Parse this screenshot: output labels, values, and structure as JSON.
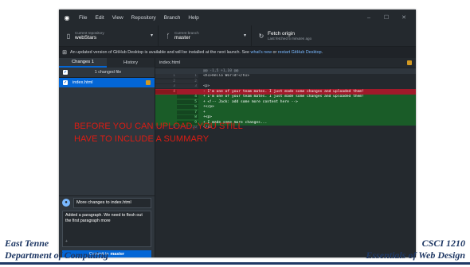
{
  "window": {
    "menus": [
      "File",
      "Edit",
      "View",
      "Repository",
      "Branch",
      "Help"
    ],
    "controls": [
      "–",
      "☐",
      "✕"
    ]
  },
  "toolbar": {
    "repository": {
      "caption": "Current repository",
      "value": "webStars",
      "icon": "repo-icon"
    },
    "branch": {
      "caption": "Current branch",
      "value": "master",
      "icon": "branch-icon"
    },
    "fetch": {
      "title": "Fetch origin",
      "subtitle": "Last fetched 5 minutes ago",
      "icon": "sync-icon"
    }
  },
  "banner": {
    "text": "An updated version of GitHub Desktop is available and will be installed at the next launch. See",
    "link1": "what's new",
    "middle": "or",
    "link2": "restart GitHub Desktop",
    "end": "."
  },
  "sidebar": {
    "tabs": [
      {
        "label": "Changes",
        "badge": "1",
        "active": true
      },
      {
        "label": "History",
        "active": false
      }
    ],
    "changed_header": "1 changed file",
    "files": [
      {
        "name": "index.html",
        "status": "modified"
      }
    ]
  },
  "commit": {
    "summary": "More changes to index.html",
    "description": "Added a paragraph. We need to flesh out the first paragraph more",
    "coauthor_glyph": "+",
    "button_prefix": "Commit to",
    "button_branch": "master"
  },
  "diff": {
    "file": "index.html",
    "lines": [
      {
        "type": "hunk",
        "old": "",
        "new": "",
        "text": "@@ -1,5 +1,10 @@"
      },
      {
        "type": "ctx",
        "old": "1",
        "new": "1",
        "text": "<h1>Hello World!</h1>"
      },
      {
        "type": "ctx",
        "old": "2",
        "new": "2",
        "text": ""
      },
      {
        "type": "ctx",
        "old": "3",
        "new": "3",
        "text": "<p>"
      },
      {
        "type": "del",
        "old": "4",
        "new": "",
        "text": "-   I'm one of your team mates. I just made some changes and uploaded them!"
      },
      {
        "type": "add",
        "old": "",
        "new": "4",
        "text": "+   I'm one of your team mates. I just made some changes and uploaded them!"
      },
      {
        "type": "add",
        "old": "",
        "new": "5",
        "text": "+   <!-- Jack: add some more content here -->"
      },
      {
        "type": "add",
        "old": "",
        "new": "6",
        "text": "+</p>"
      },
      {
        "type": "add",
        "old": "",
        "new": "7",
        "text": "+"
      },
      {
        "type": "add",
        "old": "",
        "new": "8",
        "text": "+<p>"
      },
      {
        "type": "add",
        "old": "",
        "new": "9",
        "text": "+   I made some more changes..."
      },
      {
        "type": "ctx",
        "old": "5",
        "new": "10",
        "text": "</p>"
      }
    ]
  },
  "instruction": "BEFORE YOU CAN UPLOAD, YOU STILL HAVE TO INCLUDE A SUMMARY",
  "footer": {
    "left_line1": "East Tenne",
    "left_line2": "Department of Computing",
    "right_line1": "CSCI 1210",
    "right_line2": "Essentials of Web Design"
  },
  "colors": {
    "accent": "#0366d6",
    "deletion": "#a11a2a",
    "addition": "#1a5c28",
    "instruction": "#dc1c13",
    "footer": "#1f3864"
  }
}
